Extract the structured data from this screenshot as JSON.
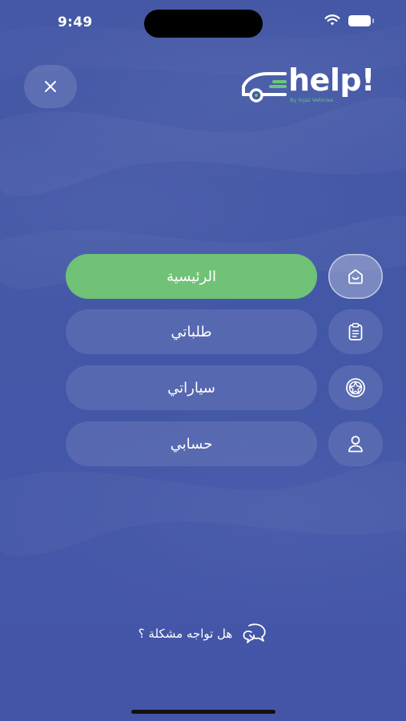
{
  "status_bar": {
    "time": "9:49",
    "icons": [
      "signal-icon",
      "wifi-icon",
      "battery-icon"
    ]
  },
  "header": {
    "close_icon": "close-icon",
    "logo": {
      "text": "help!",
      "subtext": "By Injaz Vehicles",
      "icon": "car-icon"
    }
  },
  "menu": {
    "items": [
      {
        "label": "الرئيسية",
        "icon": "home-icon",
        "active": true
      },
      {
        "label": "طلباتي",
        "icon": "clipboard-icon",
        "active": false
      },
      {
        "label": "سياراتي",
        "icon": "wheel-icon",
        "active": false
      },
      {
        "label": "حسابي",
        "icon": "user-icon",
        "active": false
      }
    ]
  },
  "help": {
    "label": "هل تواجه مشكلة ؟",
    "icon": "chat-bubbles-icon"
  },
  "colors": {
    "background": "#4357a7",
    "active_pill": "#6fc276",
    "logo_accent": "#6cc57c",
    "text": "#ffffff"
  }
}
